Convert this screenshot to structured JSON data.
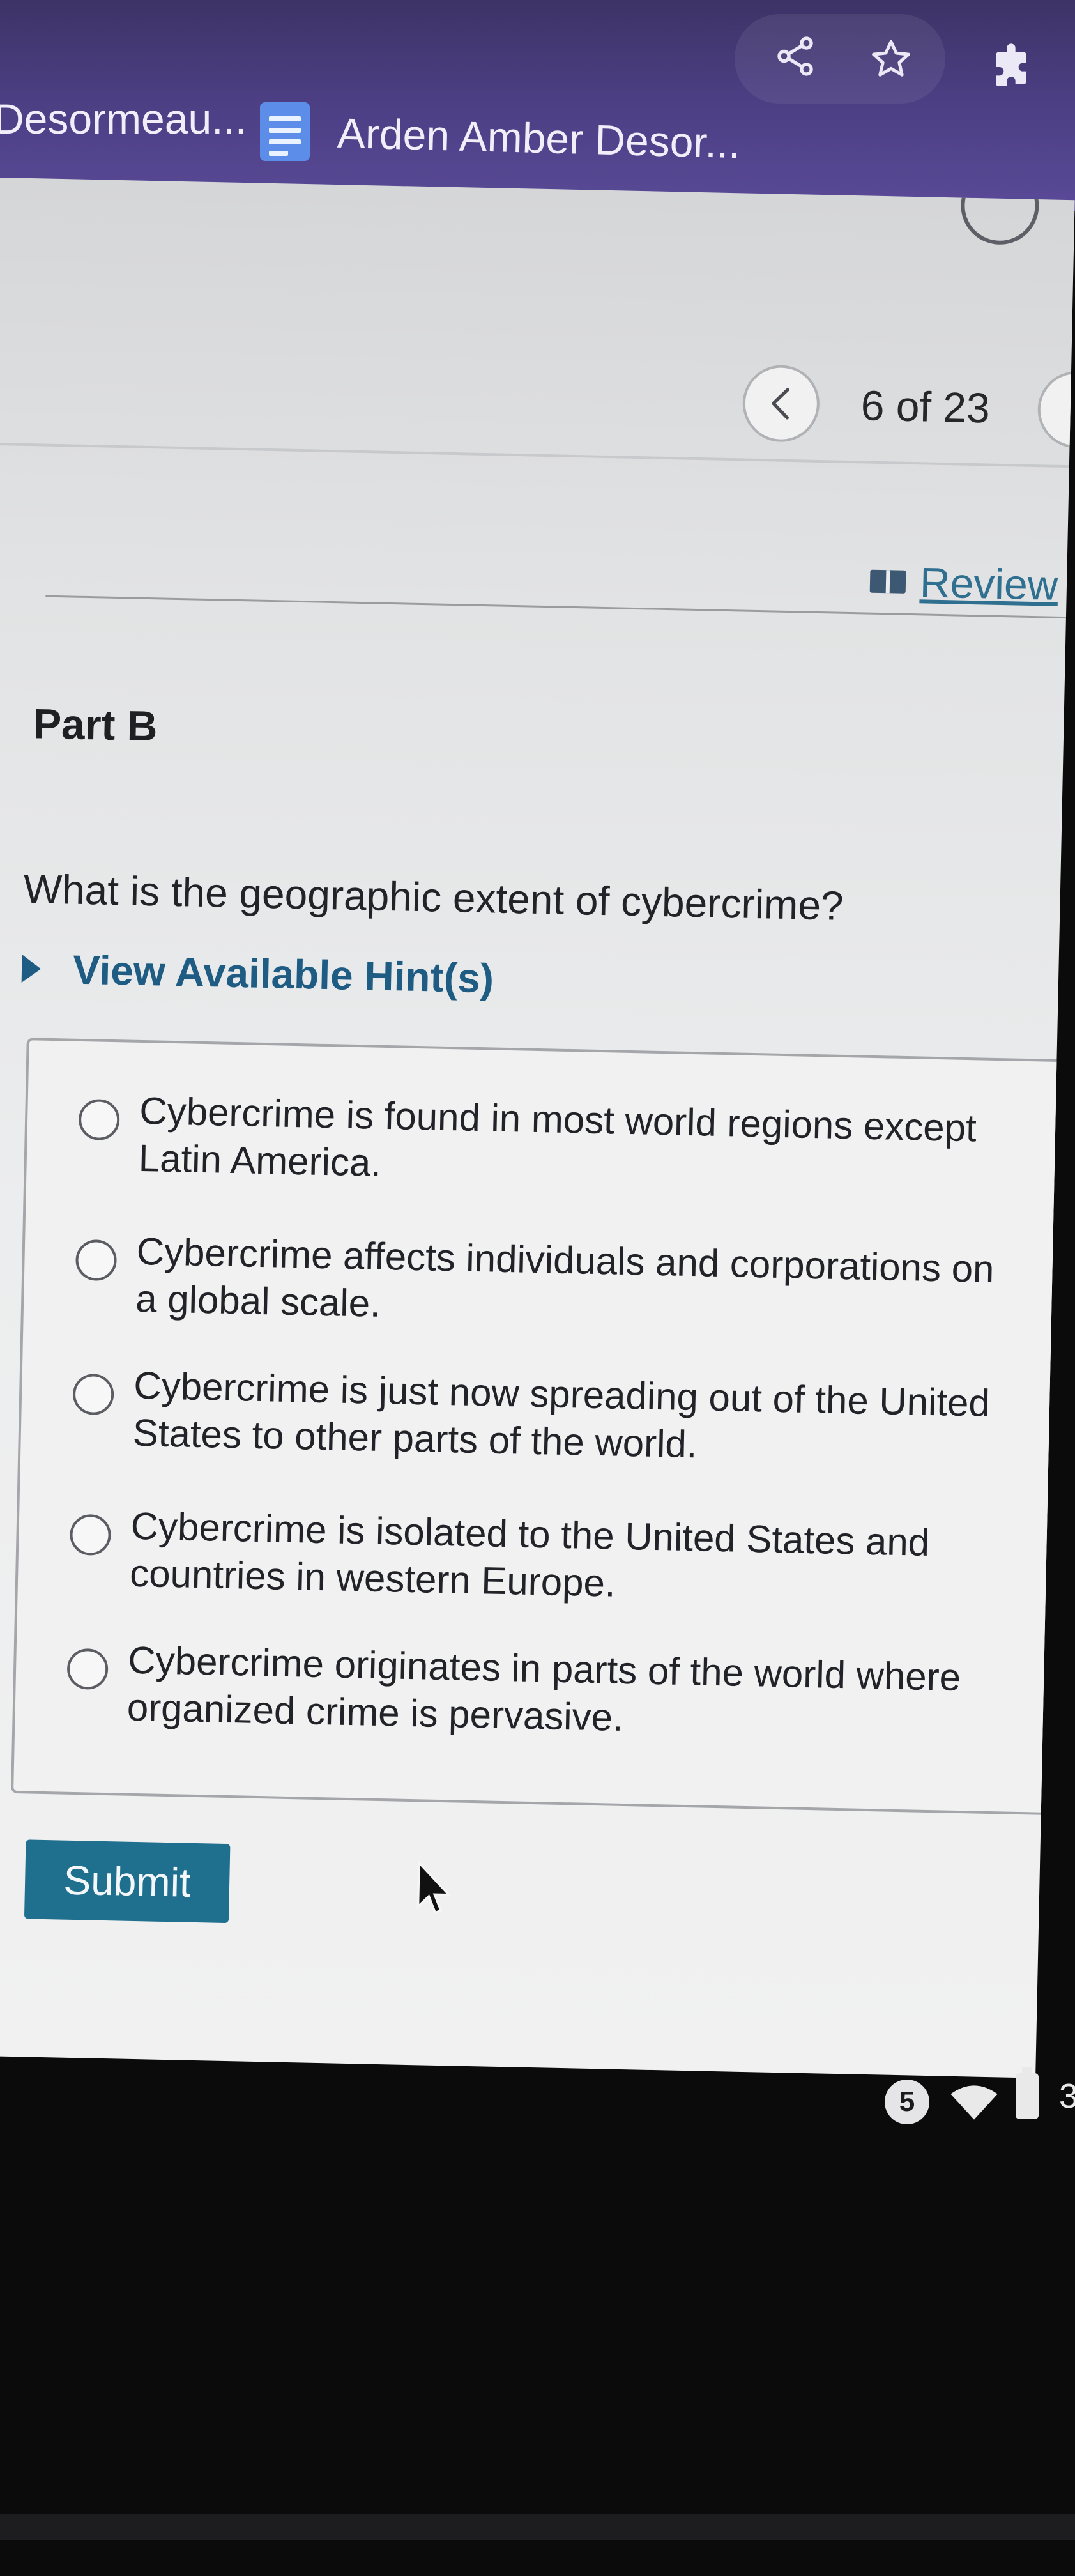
{
  "browser": {
    "bookmark_left": "Desormeau...",
    "bookmark_right": "Arden Amber Desor...",
    "toolbar_icons": [
      "share-icon",
      "star-icon",
      "extensions-icon"
    ]
  },
  "nav": {
    "counter": "6 of 23",
    "prev_icon": "chevron-left-icon"
  },
  "review": {
    "label": "Review",
    "icon": "book-icon"
  },
  "part": {
    "title": "Part B"
  },
  "question": {
    "text": "What is the geographic extent of cybercrime?",
    "hint_label": "View Available Hint(s)",
    "options": [
      "Cybercrime is found in most world regions except Latin America.",
      "Cybercrime affects individuals and corporations on a global scale.",
      "Cybercrime is just now spreading out of the United States to other parts of the world.",
      "Cybercrime is isolated to the United States and countries in western Europe.",
      "Cybercrime originates in parts of the world where organized crime is pervasive."
    ]
  },
  "submit": {
    "label": "Submit"
  },
  "status_tray": {
    "notification_count": "5",
    "clock_fragment": "3"
  },
  "colors": {
    "chrome_bg": "#4b3e82",
    "link": "#1e5c84",
    "submit_bg": "#1f6f8e"
  }
}
